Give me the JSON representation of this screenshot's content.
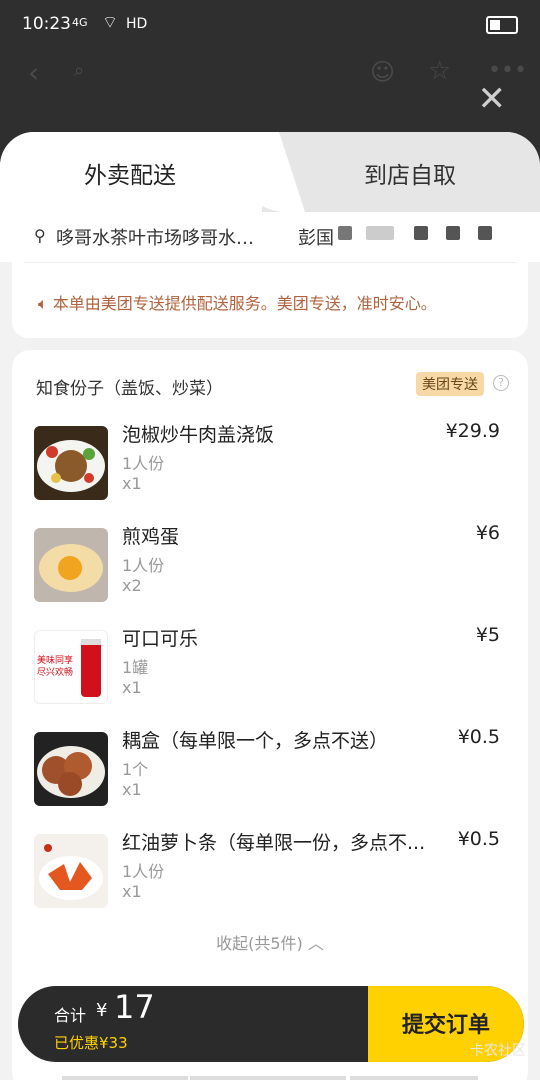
{
  "status_bar": {
    "time": "10:23",
    "signal": "4G",
    "network": "HD"
  },
  "header": {
    "back_icon": "back-arrow-icon",
    "search_placeholder": ""
  },
  "tabs": [
    {
      "label": "外卖配送"
    },
    {
      "label": "到店自取"
    }
  ],
  "address": {
    "text": "哆哥水茶叶市场哆哥水…",
    "name": "彭国"
  },
  "notice": {
    "text": "本单由美团专送提供配送服务。美团专送，准时安心。"
  },
  "shop": {
    "name": "知食份子（盖饭、炒菜）",
    "badge": "美团专送",
    "help": "?"
  },
  "items": [
    {
      "name": "泡椒炒牛肉盖浇饭",
      "qty": "1人份",
      "count": "x1",
      "price": "¥29.9"
    },
    {
      "name": "煎鸡蛋",
      "qty": "1人份",
      "count": "x2",
      "price": "¥6"
    },
    {
      "name": "可口可乐",
      "qty": "1罐",
      "count": "x1",
      "price": "¥5",
      "image_text": [
        "美味同享",
        "尽兴欢畅"
      ]
    },
    {
      "name": "耦盒（每单限一个，多点不送）",
      "qty": "1个",
      "count": "x1",
      "price": "¥0.5"
    },
    {
      "name": "红油萝卜条（每单限一份，多点不...",
      "qty": "1人份",
      "count": "x1",
      "price": "¥0.5"
    }
  ],
  "collapse": {
    "label": "收起(共5件)"
  },
  "footer": {
    "total_label": "合计",
    "currency": "¥",
    "total_value": "17",
    "discount": "已优惠¥33",
    "submit_label": "提交订单"
  },
  "watermark": "卡农社区",
  "colors": {
    "accent": "#ffd100",
    "notice": "#b0623c",
    "badge_bg": "#f6d9a6"
  }
}
